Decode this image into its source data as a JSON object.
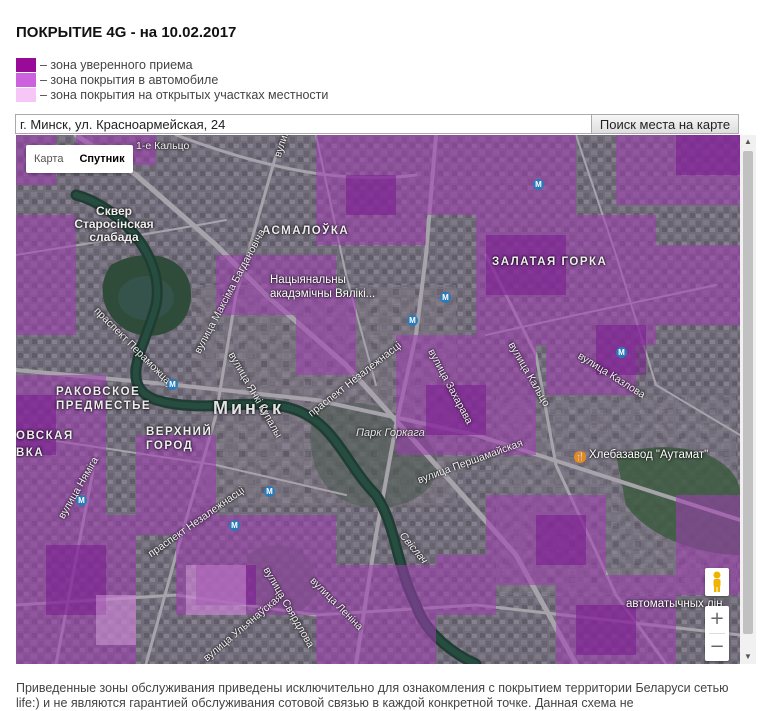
{
  "page": {
    "title": "ПОКРЫТИЕ 4G - на 10.02.2017"
  },
  "legend": [
    {
      "label": "– зона уверенного приема",
      "color": "#9a0a99"
    },
    {
      "label": "– зона покрытия в автомобиле",
      "color": "#cc62dd"
    },
    {
      "label": "– зона покрытия на открытых участках местности",
      "color": "#f6c6f6"
    }
  ],
  "search": {
    "value": "г. Минск, ул. Красноармейская, 24",
    "button_label": "Поиск места на карте"
  },
  "map": {
    "type_buttons": [
      "Карта",
      "Спутник"
    ],
    "active_type": "Спутник",
    "districts": [
      "Сквер Старосінская слабада",
      "АСМАЛОЎКА",
      "ЗАЛАТАЯ ГОРКА",
      "РАКОВСКОЕ ПРЕДМЕСТЬЕ",
      "ВЕРХНИЙ ГОРОД",
      "ОВСКАЯ",
      "ВКА"
    ],
    "city": "Минск",
    "park": "Парк Горкага",
    "pois": [
      "Нацыянальны акадэмічны Вялікі...",
      "Хлебазавод \"Аутамат\"",
      "автоматычных лін"
    ],
    "streets": [
      "1-е Кальцо",
      "вулица Масла",
      "вулица Максіма Багдановіча",
      "праспект Пераможцаў",
      "вулица Янкі Купалы",
      "праспект Незалежнасці",
      "вулица Захарава",
      "вулица Кальцо",
      "вулица Казлова",
      "вулица Першамайская",
      "вулица Ульянаўская",
      "вулица Леніна",
      "вулица Нямiга",
      "праспект Незалежнасці",
      "вулица Свярдлова",
      "Свіслач"
    ],
    "zoom_in": "+",
    "zoom_out": "−",
    "coverage_color": "#a03cb4",
    "strong_coverage_color": "#7a1a90"
  },
  "footer": {
    "text": "Приведенные зоны обслуживания приведены исключительно для ознакомления с покрытием территории Беларуси сетью life:) и не являются гарантией обслуживания сотовой связью в каждой конкретной точке. Данная схема не"
  }
}
